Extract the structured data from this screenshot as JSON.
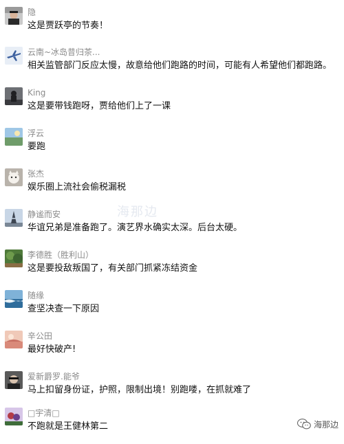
{
  "comments": [
    {
      "user": "隐",
      "text": "这是贾跃亭的节奏！"
    },
    {
      "user": "云南~冰岛昔归茶...",
      "text": "相关监管部门反应太慢，故意给他们跑路的时间，可能有人希望他们都跑路。"
    },
    {
      "user": "King",
      "text": "这是要带钱跑呀，贾给他们上了一课"
    },
    {
      "user": "浮云",
      "text": "要跑"
    },
    {
      "user": "张杰",
      "text": "娱乐圈上流社会偷税漏税"
    },
    {
      "user": "静谧而安",
      "text": "华谊兄弟是准备跑了。演艺界水确实太深。后台太硬。"
    },
    {
      "user": "李德胜（胜利山）",
      "text": "这是要投敌叛国了，有关部门抓紧冻结资金"
    },
    {
      "user": "随缘",
      "text": "查坚决查一下原因"
    },
    {
      "user": "辛公田",
      "text": "最好快破产!"
    },
    {
      "user": "爱新爵罗.能爷",
      "text": "马上扣留身份证，护照，限制出境！别跑喽，在抓就难了"
    },
    {
      "user": "□宇清□",
      "text": "不跑就是王健林第二"
    }
  ],
  "watermark": "海那边",
  "brand": {
    "name": "海那边",
    "icon": "wechat-icon"
  }
}
